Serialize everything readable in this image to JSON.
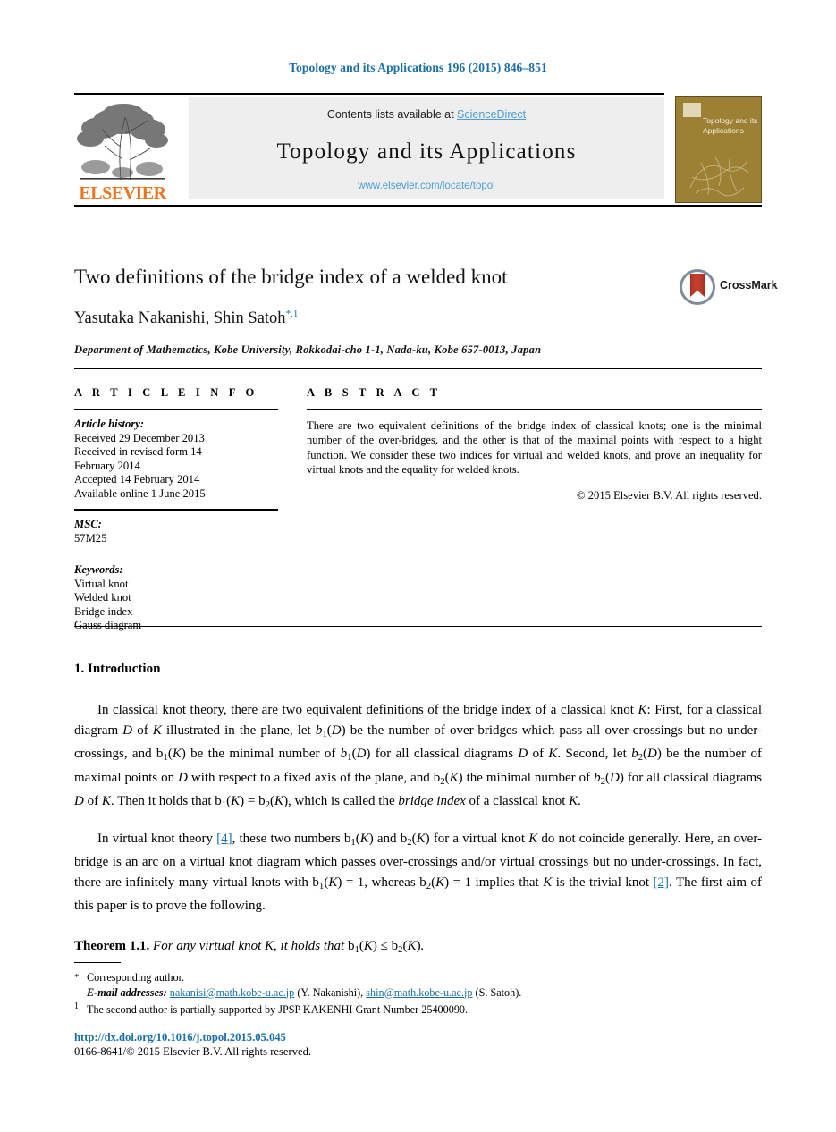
{
  "running_head": "Topology and its Applications 196 (2015) 846–851",
  "masthead": {
    "contents_prefix": "Contents lists available at ",
    "sciencedirect_link": "ScienceDirect",
    "journal_title": "Topology and its Applications",
    "journal_url": "www.elsevier.com/locate/topol",
    "publisher_wordmark": "ELSEVIER",
    "cover_title": "Topology and its Applications"
  },
  "article": {
    "title": "Two definitions of the bridge index of a welded knot",
    "authors": "Yasutaka Nakanishi, Shin Satoh",
    "author_marks": "*,1",
    "affiliation": "Department of Mathematics, Kobe University, Rokkodai-cho 1-1, Nada-ku, Kobe 657-0013, Japan",
    "crossmark_label": "CrossMark"
  },
  "info": {
    "heading": "A R T I C L E   I N F O",
    "history_label": "Article history:",
    "history_lines": [
      "Received 29 December 2013",
      "Received in revised form 14",
      "February 2014",
      "Accepted 14 February 2014",
      "Available online 1 June 2015"
    ],
    "msc_label": "MSC:",
    "msc_value": "57M25",
    "keywords_label": "Keywords:",
    "keywords": [
      "Virtual knot",
      "Welded knot",
      "Bridge index",
      "Gauss diagram"
    ]
  },
  "abstract": {
    "heading": "A B S T R A C T",
    "text": "There are two equivalent definitions of the bridge index of classical knots; one is the minimal number of the over-bridges, and the other is that of the maximal points with respect to a hight function. We consider these two indices for virtual and welded knots, and prove an inequality for virtual knots and the equality for welded knots.",
    "copyright": "© 2015 Elsevier B.V. All rights reserved."
  },
  "body": {
    "section_number": "1.",
    "section_title": "Introduction",
    "theorem_label": "Theorem 1.1.",
    "citations": {
      "virtual_theory": "[4]",
      "trivial_knot": "[2]"
    }
  },
  "footnotes": {
    "corresponding_mark": "*",
    "corresponding_text": "Corresponding author.",
    "email_label": "E-mail addresses:",
    "email1": "nakanisi@math.kobe-u.ac.jp",
    "email1_owner": "(Y. Nakanishi),",
    "email2": "shin@math.kobe-u.ac.jp",
    "email2_owner": "(S. Satoh).",
    "footnote1_mark": "1",
    "footnote1_text": "The second author is partially supported by JPSP KAKENHI Grant Number 25400090."
  },
  "bottom": {
    "doi": "http://dx.doi.org/10.1016/j.topol.2015.05.045",
    "issn_copyright": "0166-8641/© 2015 Elsevier B.V. All rights reserved."
  },
  "colors": {
    "link_blue": "#1a6fa3",
    "sciencedirect_blue": "#4a9ed4",
    "elsevier_orange": "#E87722",
    "cover_olive": "#9c8034"
  }
}
